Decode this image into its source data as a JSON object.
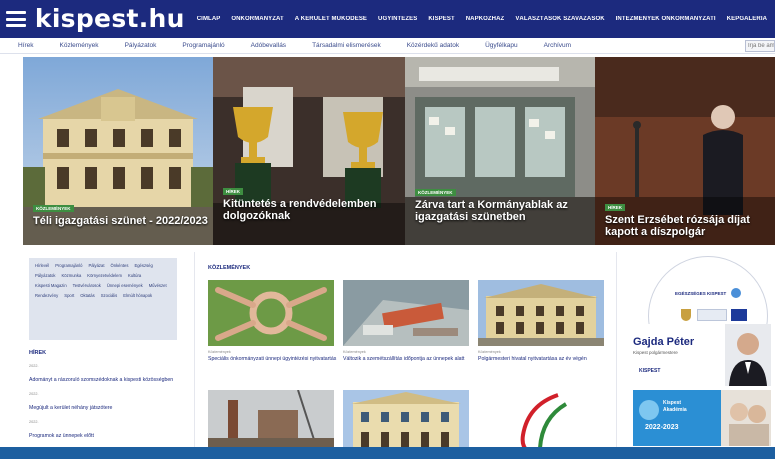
{
  "header": {
    "logo": "kispest.hu",
    "nav": [
      "Címlap",
      "Önkormányzat",
      "A kerület működése",
      "Ügyintézés",
      "Kispest",
      "Napközhaz",
      "Választások Szavazások",
      "Intézmények Önkormányzati",
      "Képgaléria"
    ]
  },
  "subnav": [
    "Hírek",
    "Közlemények",
    "Pályázatok",
    "Programajánló",
    "Adóbevallás",
    "Társadalmi elismerések",
    "Közérdekű adatok",
    "Ügyfélkapu",
    "Archívum"
  ],
  "search": {
    "placeholder": "Írja be amit keres"
  },
  "hero": [
    {
      "tag": "Közlemények",
      "title": "Téli igazgatási szünet - 2022/2023"
    },
    {
      "tag": "Hírek",
      "title": "Kitüntetés a rendvédelemben dolgozóknak"
    },
    {
      "tag": "Közlemények",
      "title": "Zárva tart a Kormányablak az igazgatási szünetben"
    },
    {
      "tag": "Hírek",
      "title": "Szent Erzsébet rózsája díjat kapott a díszpolgár"
    }
  ],
  "tagcloud": [
    "Hírlevél",
    "Programajánló",
    "Pályázat",
    "Önkéntes",
    "Egészség",
    "Pályázatok",
    "Közmunka",
    "Környezetvédelem",
    "Kultúra",
    "Kispesti Magazin",
    "Testvérvárosok",
    "Ünnepi események",
    "Művészet",
    "Rendezvény",
    "Sport",
    "Oktatás",
    "Szociális",
    "Elmúlt hónapok"
  ],
  "left": {
    "section_title": "Hírek",
    "news": [
      {
        "date": "2022.",
        "title": "Adományt a rászoruló szomszédoknak a kispesti közösségben"
      },
      {
        "date": "2022.",
        "title": "Megújult a kerület néhány játszótere"
      },
      {
        "date": "2022.",
        "title": "Programok az ünnepek előtt"
      }
    ]
  },
  "mid": {
    "section_title": "Közlemények",
    "cards": [
      {
        "date": "Közlemények",
        "title": "Speciális önkormányzati ünnepi ügyintézési nyitvatartás"
      },
      {
        "date": "Közlemények",
        "title": "Változik a szemétszállítás időpontja az ünnepek alatt"
      },
      {
        "date": "Közlemények",
        "title": "Polgármesteri hivatal nyitvatartása az év végén"
      }
    ]
  },
  "right": {
    "badge_title": "Egészséges Kispest",
    "person_name": "Gajda Péter",
    "person_role": "Kispest polgármestere",
    "brand": "KISPEST",
    "promo_line1": "Kispest",
    "promo_line2": "Akadémia",
    "promo_years": "2022-2023"
  }
}
